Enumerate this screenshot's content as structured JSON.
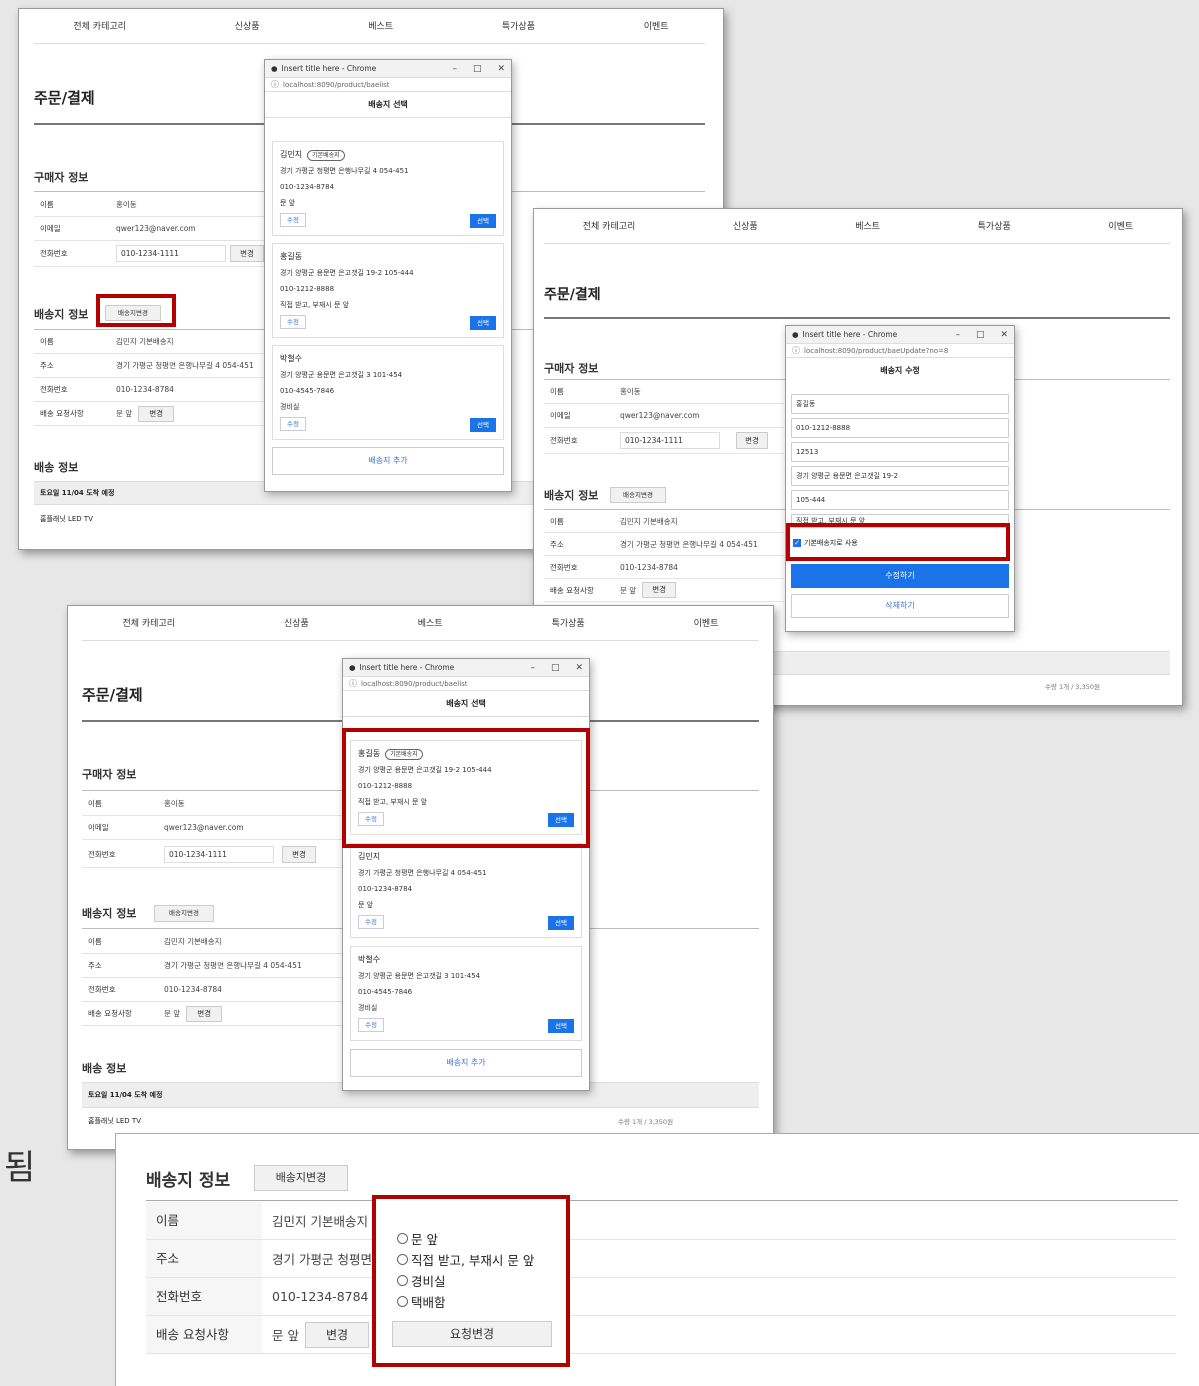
{
  "nav": [
    "전체 카테고리",
    "신상품",
    "베스트",
    "특가상품",
    "이벤트"
  ],
  "page_title": "주문/결제",
  "buyer": {
    "section": "구매자 정보",
    "name_label": "이름",
    "name": "홍이동",
    "email_label": "이메일",
    "email": "qwer123@naver.com",
    "phone_label": "전화번호",
    "phone": "010-1234-1111",
    "change_btn": "변경"
  },
  "shipping": {
    "section": "배송지 정보",
    "change_btn": "배송지변경",
    "name_label": "이름",
    "name": "김민지 기본배송지",
    "addr_label": "주소",
    "addr": "경기 가평군 청평면 은행나무길 4 054-451",
    "addr_short": "경기 가평군 청평면",
    "phone_label": "전화번호",
    "phone": "010-1234-8784",
    "req_label": "배송 요청사항",
    "req": "문 앞",
    "req_btn": "변경"
  },
  "delivery": {
    "section": "배송 정보",
    "date": "토요일 11/04 도착 예정",
    "product": "홈플래닛 LED TV",
    "qty_price": "수량 1개 / 3,350원"
  },
  "popup": {
    "window_title": "Insert title here - Chrome",
    "url_list": "localhost:8090/product/baelist",
    "url_update": "localhost:8090/product/baeUpdate?no=8",
    "header_select": "배송지 선택",
    "header_edit": "배송지 수정",
    "default_badge": "기본배송지",
    "modify_btn": "수정",
    "select_btn": "선택",
    "add_btn": "배송지 추가",
    "update_btn": "수정하기",
    "delete_btn": "삭제하기",
    "default_check": "기본배송지로 사용"
  },
  "addresses": [
    {
      "name": "김민지",
      "addr": "경기 가평군 청평면 은행나무길 4 054-451",
      "phone": "010-1234-8784",
      "memo": "문 앞"
    },
    {
      "name": "홍길동",
      "addr": "경기 양평군 용문면 은고갯길 19-2 105-444",
      "phone": "010-1212-8888",
      "memo": "직접 받고, 부재시 문 앞"
    },
    {
      "name": "박철수",
      "addr": "경기 양평군 용문면 은고갯길 3 101-454",
      "phone": "010-4545-7846",
      "memo": "경비실"
    }
  ],
  "edit_form": {
    "name": "홍길동",
    "phone": "010-1212-8888",
    "zip": "12513",
    "addr1": "경기 양평군 용문면 은고갯길 19-2",
    "addr2": "105-444",
    "memo": "직접 받고, 부재시 문 앞"
  },
  "side_note": "됨",
  "request_options": [
    "문 앞",
    "직접 받고, 부재시 문 앞",
    "경비실",
    "택배함"
  ],
  "request_change_btn": "요청변경",
  "colors": {
    "accent": "#1a73e8",
    "highlight": "#b30000"
  }
}
